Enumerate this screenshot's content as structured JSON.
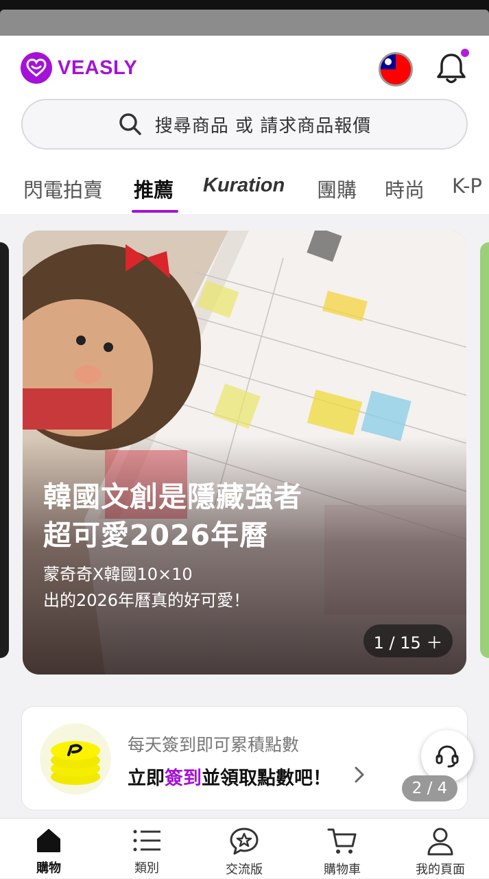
{
  "header": {
    "logo_text": "VEASLY",
    "search_placeholder": "搜尋商品 或 請求商品報價"
  },
  "tabs": [
    {
      "label": "閃電拍賣"
    },
    {
      "label": "推薦"
    },
    {
      "label": "Kuration"
    },
    {
      "label": "團購"
    },
    {
      "label": "時尚"
    },
    {
      "label": "K-P"
    }
  ],
  "banner": {
    "title_line1": "韓國文創是隱藏強者",
    "title_line2": "超可愛2026年曆",
    "subtitle_line1": "蒙奇奇X韓國10×10",
    "subtitle_line2": "出的2026年曆真的好可愛！",
    "counter": "1 / 15 ＋"
  },
  "checkin": {
    "line1": "每天簽到即可累積點數",
    "line2_pre": "立即",
    "line2_highlight": "簽到",
    "line2_post": "並領取點數吧！",
    "page_indicator": "2 / 4"
  },
  "bottom_nav": [
    {
      "label": "購物"
    },
    {
      "label": "類別"
    },
    {
      "label": "交流版"
    },
    {
      "label": "購物車"
    },
    {
      "label": "我的頁面"
    }
  ],
  "colors": {
    "brand": "#a412d8"
  }
}
